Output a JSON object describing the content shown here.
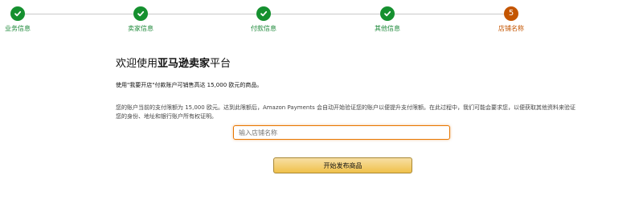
{
  "steps": [
    {
      "label": "业务信息",
      "status": "done"
    },
    {
      "label": "卖家信息",
      "status": "done"
    },
    {
      "label": "付款信息",
      "status": "done"
    },
    {
      "label": "其他信息",
      "status": "done"
    },
    {
      "label": "店铺名称",
      "status": "current",
      "number": "5"
    }
  ],
  "welcome": {
    "part1": "欢迎使用",
    "brand": "亚马逊卖家",
    "part2": "平台"
  },
  "info1": "使用\"我要开店\"付款账户可销售高达 15,000 欧元的商品。",
  "info2": "您的账户当前的支付限额为 15,000 欧元。达到此限额后，Amazon Payments 会自动开始验证您的账户以便提升支付限额。在此过程中，我们可能会要求您，以便获取其他资料来验证您的身份、地址和银行账户所有权证明。",
  "store_name": {
    "value": "",
    "placeholder": "输入店铺名称"
  },
  "start_button": "开始发布商品",
  "colors": {
    "done": "#15902f",
    "current": "#c45500",
    "input_focus": "#e77600",
    "button": "#f0c14b"
  },
  "icons": {
    "done_step": "checkmark-icon"
  }
}
